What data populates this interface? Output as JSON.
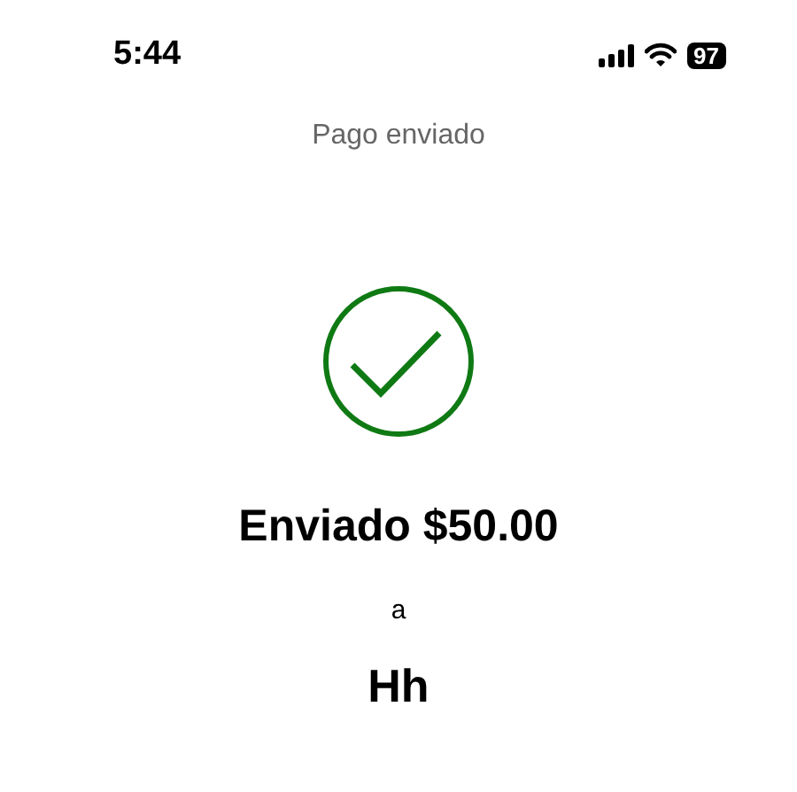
{
  "status_bar": {
    "time": "5:44",
    "battery": "97"
  },
  "title": "Pago enviado",
  "amount_line": "Enviado $50.00",
  "connector": "a",
  "recipient": "Hh"
}
